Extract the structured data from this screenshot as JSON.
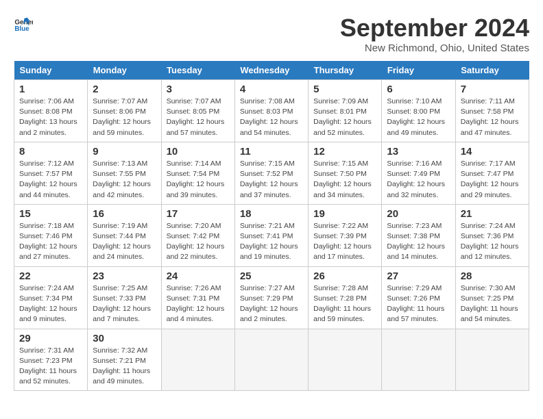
{
  "header": {
    "logo_line1": "General",
    "logo_line2": "Blue",
    "month": "September 2024",
    "location": "New Richmond, Ohio, United States"
  },
  "weekdays": [
    "Sunday",
    "Monday",
    "Tuesday",
    "Wednesday",
    "Thursday",
    "Friday",
    "Saturday"
  ],
  "weeks": [
    [
      {
        "day": "1",
        "sunrise": "7:06 AM",
        "sunset": "8:08 PM",
        "daylight": "13 hours and 2 minutes."
      },
      {
        "day": "2",
        "sunrise": "7:07 AM",
        "sunset": "8:06 PM",
        "daylight": "12 hours and 59 minutes."
      },
      {
        "day": "3",
        "sunrise": "7:07 AM",
        "sunset": "8:05 PM",
        "daylight": "12 hours and 57 minutes."
      },
      {
        "day": "4",
        "sunrise": "7:08 AM",
        "sunset": "8:03 PM",
        "daylight": "12 hours and 54 minutes."
      },
      {
        "day": "5",
        "sunrise": "7:09 AM",
        "sunset": "8:01 PM",
        "daylight": "12 hours and 52 minutes."
      },
      {
        "day": "6",
        "sunrise": "7:10 AM",
        "sunset": "8:00 PM",
        "daylight": "12 hours and 49 minutes."
      },
      {
        "day": "7",
        "sunrise": "7:11 AM",
        "sunset": "7:58 PM",
        "daylight": "12 hours and 47 minutes."
      }
    ],
    [
      {
        "day": "8",
        "sunrise": "7:12 AM",
        "sunset": "7:57 PM",
        "daylight": "12 hours and 44 minutes."
      },
      {
        "day": "9",
        "sunrise": "7:13 AM",
        "sunset": "7:55 PM",
        "daylight": "12 hours and 42 minutes."
      },
      {
        "day": "10",
        "sunrise": "7:14 AM",
        "sunset": "7:54 PM",
        "daylight": "12 hours and 39 minutes."
      },
      {
        "day": "11",
        "sunrise": "7:15 AM",
        "sunset": "7:52 PM",
        "daylight": "12 hours and 37 minutes."
      },
      {
        "day": "12",
        "sunrise": "7:15 AM",
        "sunset": "7:50 PM",
        "daylight": "12 hours and 34 minutes."
      },
      {
        "day": "13",
        "sunrise": "7:16 AM",
        "sunset": "7:49 PM",
        "daylight": "12 hours and 32 minutes."
      },
      {
        "day": "14",
        "sunrise": "7:17 AM",
        "sunset": "7:47 PM",
        "daylight": "12 hours and 29 minutes."
      }
    ],
    [
      {
        "day": "15",
        "sunrise": "7:18 AM",
        "sunset": "7:46 PM",
        "daylight": "12 hours and 27 minutes."
      },
      {
        "day": "16",
        "sunrise": "7:19 AM",
        "sunset": "7:44 PM",
        "daylight": "12 hours and 24 minutes."
      },
      {
        "day": "17",
        "sunrise": "7:20 AM",
        "sunset": "7:42 PM",
        "daylight": "12 hours and 22 minutes."
      },
      {
        "day": "18",
        "sunrise": "7:21 AM",
        "sunset": "7:41 PM",
        "daylight": "12 hours and 19 minutes."
      },
      {
        "day": "19",
        "sunrise": "7:22 AM",
        "sunset": "7:39 PM",
        "daylight": "12 hours and 17 minutes."
      },
      {
        "day": "20",
        "sunrise": "7:23 AM",
        "sunset": "7:38 PM",
        "daylight": "12 hours and 14 minutes."
      },
      {
        "day": "21",
        "sunrise": "7:24 AM",
        "sunset": "7:36 PM",
        "daylight": "12 hours and 12 minutes."
      }
    ],
    [
      {
        "day": "22",
        "sunrise": "7:24 AM",
        "sunset": "7:34 PM",
        "daylight": "12 hours and 9 minutes."
      },
      {
        "day": "23",
        "sunrise": "7:25 AM",
        "sunset": "7:33 PM",
        "daylight": "12 hours and 7 minutes."
      },
      {
        "day": "24",
        "sunrise": "7:26 AM",
        "sunset": "7:31 PM",
        "daylight": "12 hours and 4 minutes."
      },
      {
        "day": "25",
        "sunrise": "7:27 AM",
        "sunset": "7:29 PM",
        "daylight": "12 hours and 2 minutes."
      },
      {
        "day": "26",
        "sunrise": "7:28 AM",
        "sunset": "7:28 PM",
        "daylight": "11 hours and 59 minutes."
      },
      {
        "day": "27",
        "sunrise": "7:29 AM",
        "sunset": "7:26 PM",
        "daylight": "11 hours and 57 minutes."
      },
      {
        "day": "28",
        "sunrise": "7:30 AM",
        "sunset": "7:25 PM",
        "daylight": "11 hours and 54 minutes."
      }
    ],
    [
      {
        "day": "29",
        "sunrise": "7:31 AM",
        "sunset": "7:23 PM",
        "daylight": "11 hours and 52 minutes."
      },
      {
        "day": "30",
        "sunrise": "7:32 AM",
        "sunset": "7:21 PM",
        "daylight": "11 hours and 49 minutes."
      },
      null,
      null,
      null,
      null,
      null
    ]
  ]
}
